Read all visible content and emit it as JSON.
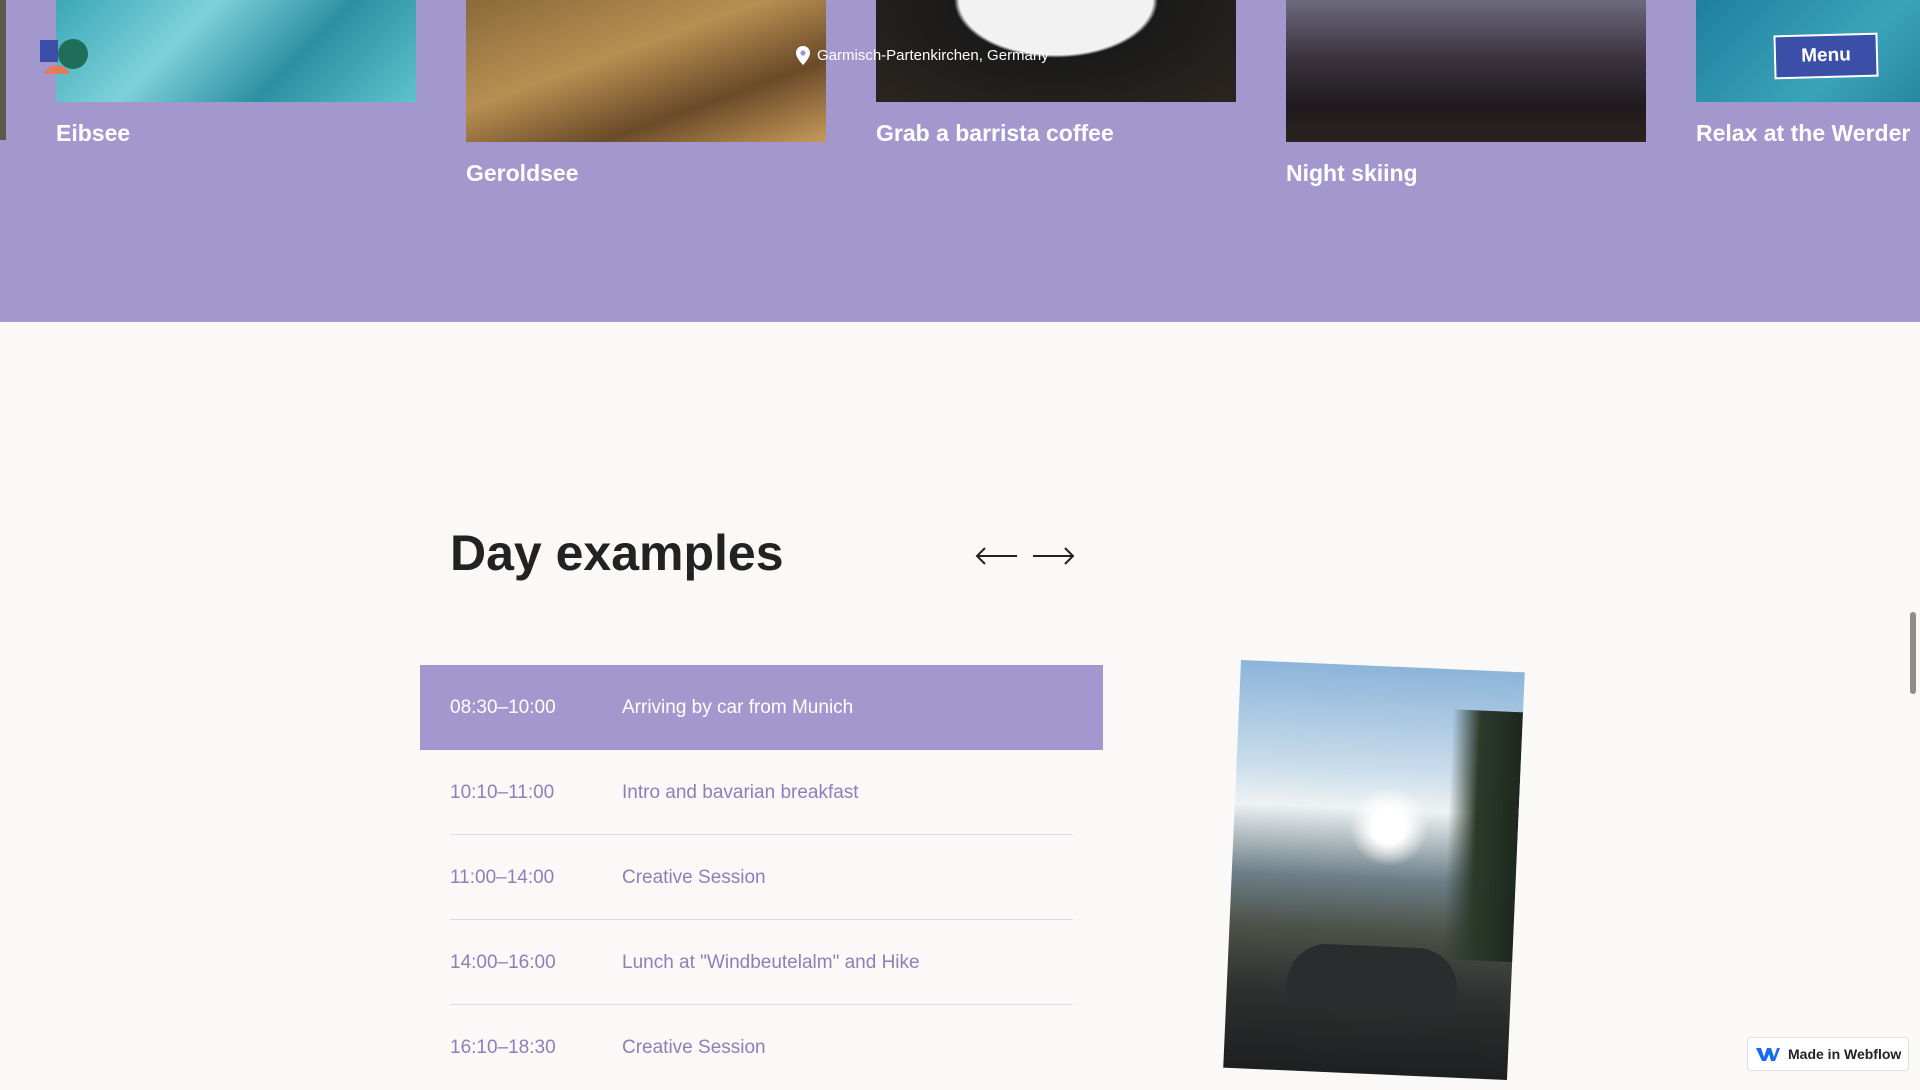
{
  "header": {
    "location": "Garmisch-Partenkirchen, Germany",
    "menu_label": "Menu"
  },
  "gallery": {
    "cards": [
      {
        "title": "Eibsee"
      },
      {
        "title": "Geroldsee"
      },
      {
        "title": "Grab a barrista coffee"
      },
      {
        "title": "Night skiing"
      },
      {
        "title": "Relax at the Werder"
      }
    ]
  },
  "day_examples": {
    "heading": "Day examples",
    "schedule": [
      {
        "time": "08:30–10:00",
        "activity": "Arriving by car from Munich",
        "active": true
      },
      {
        "time": "10:10–11:00",
        "activity": "Intro and bavarian breakfast",
        "active": false
      },
      {
        "time": "11:00–14:00",
        "activity": "Creative Session",
        "active": false
      },
      {
        "time": "14:00–16:00",
        "activity": "Lunch at \"Windbeutelalm\" and Hike",
        "active": false
      },
      {
        "time": "16:10–18:30",
        "activity": "Creative Session",
        "active": false
      }
    ]
  },
  "badge": {
    "label": "Made in Webflow"
  },
  "colors": {
    "accent_purple": "#a398cd",
    "menu_blue": "#3b4fa8",
    "inactive_text": "#8c80b8"
  }
}
